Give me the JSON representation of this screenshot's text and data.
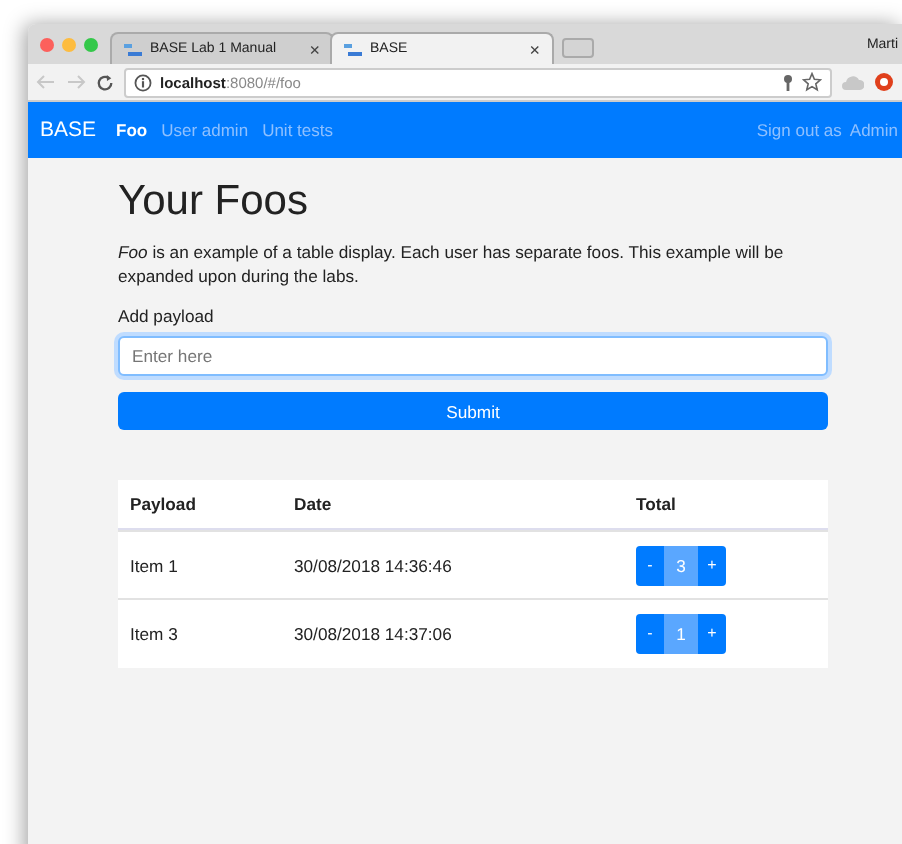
{
  "browser": {
    "tabs": [
      {
        "title": "BASE Lab 1 Manual",
        "selected": false
      },
      {
        "title": "BASE",
        "selected": true
      }
    ],
    "tab_close": "×",
    "profile": "Marti",
    "address": {
      "host": "localhost",
      "rest": ":8080/#/foo"
    }
  },
  "navbar": {
    "brand": "BASE",
    "links": [
      {
        "label": "Foo",
        "selected": true
      },
      {
        "label": "User admin",
        "selected": false
      },
      {
        "label": "Unit tests",
        "selected": false
      }
    ],
    "sign_out": "Sign out as",
    "user": "Admin"
  },
  "page": {
    "title": "Your Foos",
    "intro": "*Foo* is an example of a table display. Each user has separate foos. This example will be expanded upon during the labs.",
    "field_label": "Add payload",
    "placeholder": "Enter here",
    "submit": "Submit"
  },
  "table": {
    "columns": [
      "Payload",
      "Date",
      "Total"
    ],
    "rows": [
      {
        "payload": "Item 1",
        "date": "30/08/2018 14:36:46",
        "total": "3"
      },
      {
        "payload": "Item 3",
        "date": "30/08/2018 14:37:06",
        "total": "1"
      }
    ],
    "decrement": "-",
    "increment": "+"
  }
}
